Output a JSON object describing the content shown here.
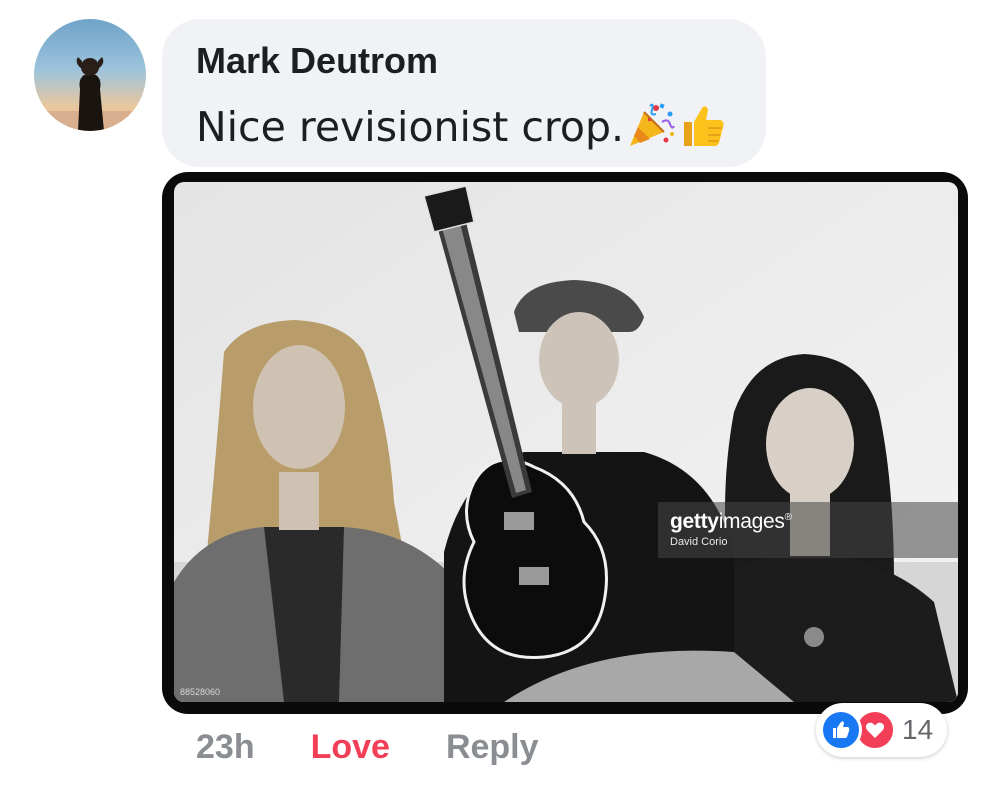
{
  "comment": {
    "author": "Mark Deutrom",
    "text": "Nice revisionist crop.",
    "emojis": [
      "party-popper-icon",
      "thumbs-up-icon"
    ]
  },
  "photo": {
    "watermark_brand_bold": "getty",
    "watermark_brand_light": "images",
    "watermark_registered": "®",
    "watermark_credit": "David Corio",
    "image_id": "88528060"
  },
  "actions": {
    "timestamp": "23h",
    "love_label": "Love",
    "reply_label": "Reply"
  },
  "reactions": {
    "icons": [
      "like-icon",
      "heart-icon"
    ],
    "count": "14"
  },
  "colors": {
    "love_accent": "#f33e58",
    "like_blue": "#1877f2",
    "muted_gray": "#8a8d91",
    "bubble_bg": "#f0f2f5"
  }
}
